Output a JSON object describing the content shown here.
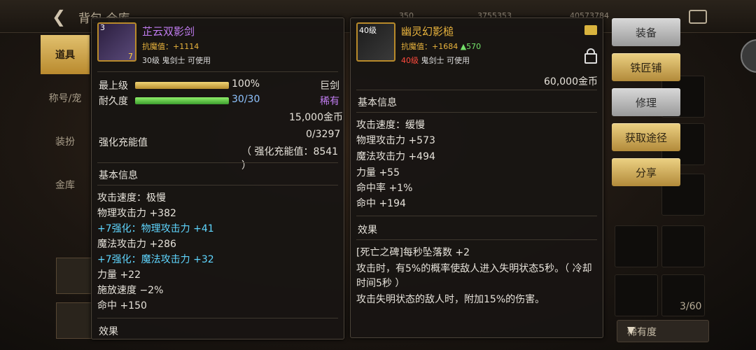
{
  "top": {
    "back_label": "背包",
    "title_fragment": "仓库",
    "stat1": "350",
    "stat2": "3755353",
    "stat3": "40573784"
  },
  "left_nav": [
    "道具",
    "称号/宠",
    "装扮",
    "金库"
  ],
  "inventory": {
    "count": "3/60",
    "sort_label": "稀有度"
  },
  "buttons": {
    "equip": "装备",
    "smith": "铁匠铺",
    "repair": "修理",
    "obtain": "获取途径",
    "share": "分享"
  },
  "item1": {
    "icon_badge": "3",
    "icon_tag": "7",
    "name": "芷云双影剑",
    "resist_label": "抗魔值：",
    "resist_value": "+1114",
    "req": "30级 鬼剑士 可使用",
    "max_label": "最上级",
    "max_value": "100%",
    "type": "巨剑",
    "dur_label": "耐久度",
    "dur_value": "30/30",
    "rarity": "稀有",
    "price": "15,000金币",
    "charge_label": "强化充能值",
    "charge_value": "0/3297",
    "charge_note": "（ 强化充能值：8541 ）",
    "basic_title": "基本信息",
    "stats": [
      "攻击速度：极慢",
      "物理攻击力 +382",
      "+7强化：物理攻击力 +41",
      "魔法攻击力 +286",
      "+7强化：魔法攻击力 +32",
      "力量 +22",
      "施放速度 −2%",
      "命中 +150"
    ],
    "effect_title": "效果",
    "max_fill": 1.0,
    "dur_fill": 1.0
  },
  "item2": {
    "level_badge": "40级",
    "name": "幽灵幻影槌",
    "resist_label": "抗魔值：",
    "resist_value": "+1684",
    "resist_diff": "▲570",
    "req_level": "40级",
    "req_rest": " 鬼剑士 可使用",
    "price": "60,000金币",
    "basic_title": "基本信息",
    "stats": [
      "攻击速度：缓慢",
      "物理攻击力 +573",
      "魔法攻击力 +494",
      "力量 +55",
      "命中率 +1%",
      "命中 +194"
    ],
    "effect_title": "效果",
    "effects": [
      "[死亡之碑]每秒坠落数 +2",
      "攻击时，有5%的概率使敌人进入失明状态5秒。（ 冷却",
      "时间5秒 ）",
      "攻击失明状态的敌人时，附加15%的伤害。"
    ]
  },
  "colors": {
    "gold": "#e9b43d",
    "purple": "#c07cf0",
    "cyan": "#5fd6ff",
    "green": "#74e36a",
    "red": "#ff4a3d"
  }
}
